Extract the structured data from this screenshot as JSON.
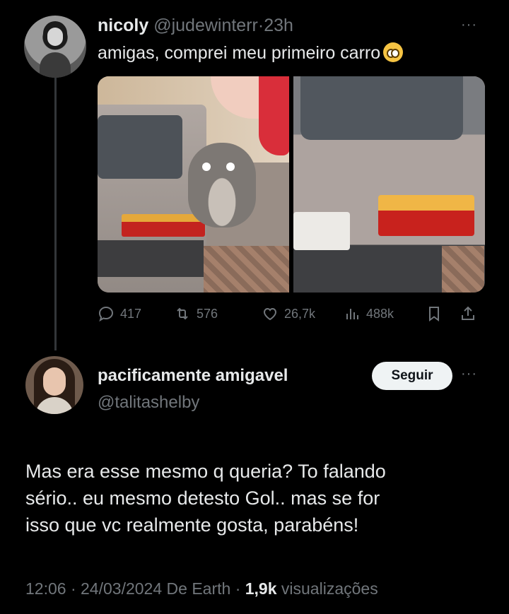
{
  "tweet1": {
    "display_name": "nicoly",
    "handle": "@judewinterr",
    "separator": "·",
    "time": "23h",
    "text": "amigas, comprei meu primeiro carro",
    "emoji": "pleading-face-emoji",
    "stats": {
      "replies": "417",
      "retweets": "576",
      "likes": "26,7k",
      "views": "488k"
    }
  },
  "tweet2": {
    "display_name": "pacificamente amigavel",
    "handle": "@talitashelby",
    "follow_label": "Seguir",
    "body_lines": [
      "Mas era esse mesmo q queria? To falando",
      "sério.. eu mesmo detesto Gol.. mas se for",
      "isso que vc realmente gosta, parabéns!"
    ],
    "meta": {
      "time": "12:06",
      "sep1": "·",
      "date": "24/03/2024",
      "source": "De Earth",
      "sep2": "·",
      "views_count": "1,9k",
      "views_label": "visualizações"
    }
  },
  "more_label": "···",
  "colors": {
    "background": "#000000",
    "text": "#e7e9ea",
    "secondary": "#71767b",
    "follow_bg": "#eff3f4"
  }
}
